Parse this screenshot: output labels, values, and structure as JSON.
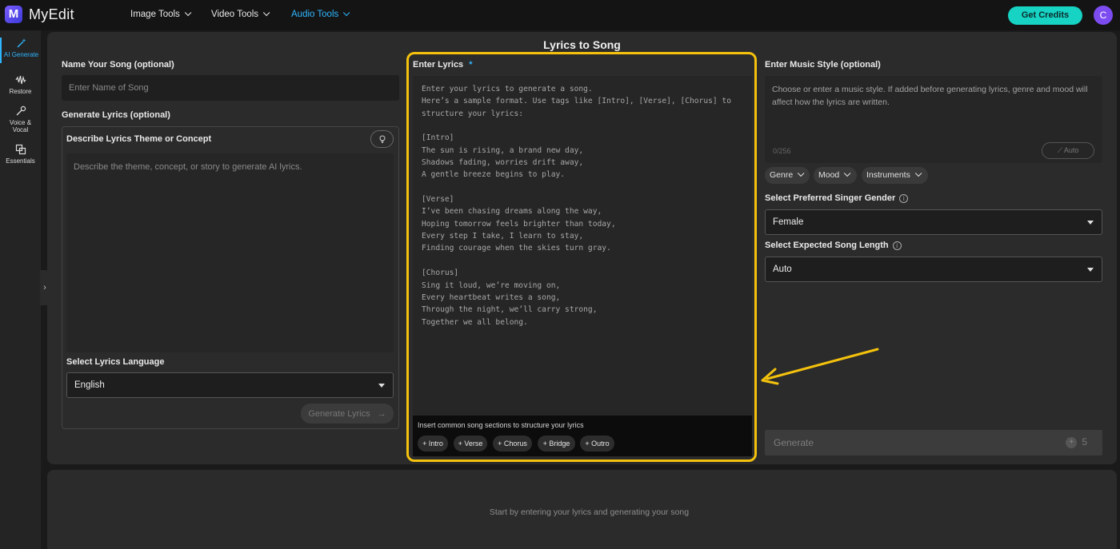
{
  "app": {
    "logo_letter": "M",
    "name": "MyEdit"
  },
  "nav": [
    {
      "label": "Image Tools"
    },
    {
      "label": "Video Tools"
    },
    {
      "label": "Audio Tools"
    }
  ],
  "header": {
    "credits_button": "Get Credits",
    "avatar_letter": "C"
  },
  "rail": [
    {
      "label": "AI Generate",
      "icon": "magic-wand-icon"
    },
    {
      "label": "Restore",
      "icon": "waveform-icon"
    },
    {
      "label_line1": "Voice &",
      "label_line2": "Vocal",
      "icon": "voice-icon"
    },
    {
      "label": "Essentials",
      "icon": "copy-icon"
    }
  ],
  "page": {
    "title": "Lyrics to Song"
  },
  "left": {
    "name_label": "Name Your Song (optional)",
    "name_placeholder": "Enter Name of Song",
    "generate_label": "Generate Lyrics (optional)",
    "theme_label": "Describe Lyrics Theme or Concept",
    "theme_placeholder": "Describe the theme, concept, or story to generate AI lyrics.",
    "language_label": "Select Lyrics Language",
    "language_value": "English",
    "generate_lyrics_button": "Generate Lyrics"
  },
  "lyrics": {
    "label": "Enter Lyrics",
    "required_mark": "*",
    "placeholder_lines": [
      "Enter your lyrics to generate a song.",
      "Here’s a sample format. Use tags like [Intro], [Verse], [Chorus] to",
      "structure your lyrics:",
      "",
      "[Intro]",
      "The sun is rising, a brand new day,",
      "Shadows fading, worries drift away,",
      "A gentle breeze begins to play.",
      "",
      "[Verse]",
      "I’ve been chasing dreams along the way,",
      "Hoping tomorrow feels brighter than today,",
      "Every step I take, I learn to stay,",
      "Finding courage when the skies turn gray.",
      "",
      "[Chorus]",
      "Sing it loud, we’re moving on,",
      "Every heartbeat writes a song,",
      "Through the night, we’ll carry strong,",
      "Together we all belong."
    ],
    "sections_hint": "Insert common song sections to structure your lyrics",
    "section_chips": [
      "+ Intro",
      "+ Verse",
      "+ Chorus",
      "+ Bridge",
      "+ Outro"
    ]
  },
  "right": {
    "style_label": "Enter Music Style (optional)",
    "style_placeholder": "Choose or enter a music style. If added before generating lyrics, genre and mood will affect how the lyrics are written.",
    "counter": "0/256",
    "auto_button": "Auto",
    "tags": [
      "Genre",
      "Mood",
      "Instruments"
    ],
    "gender_label": "Select Preferred Singer Gender",
    "gender_value": "Female",
    "length_label": "Select Expected Song Length",
    "length_value": "Auto",
    "generate_button": "Generate",
    "credit_cost": "5"
  },
  "result": {
    "hint": "Start by entering your lyrics and generating your song"
  },
  "colors": {
    "accent": "#2fb6ff",
    "credits": "#16d3c4",
    "highlight": "#f4c20d",
    "avatar": "#7d4cf1"
  }
}
